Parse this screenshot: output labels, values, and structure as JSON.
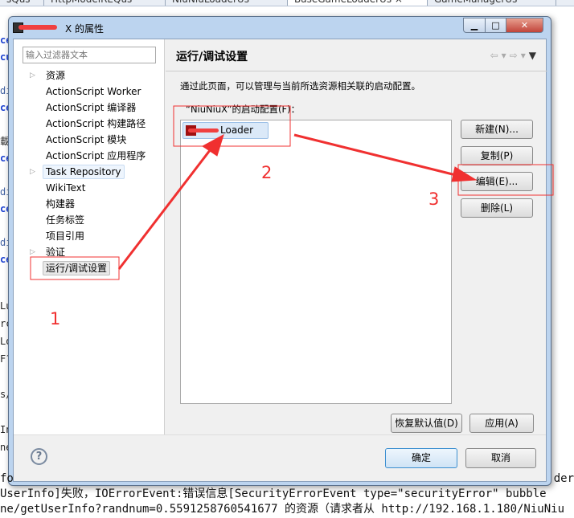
{
  "editor_tabs": [
    "sQus",
    "HttpModelREQus",
    "NiuNiuLoaderUs",
    "BaseGameLoaderUs ×",
    "GameManagerUs"
  ],
  "dialog": {
    "title": "X 的属性",
    "filter_placeholder": "输入过滤器文本",
    "tree": [
      {
        "label": "资源",
        "expandable": true
      },
      {
        "label": "ActionScript Worker"
      },
      {
        "label": "ActionScript 编译器"
      },
      {
        "label": "ActionScript 构建路径"
      },
      {
        "label": "ActionScript 模块"
      },
      {
        "label": "ActionScript 应用程序"
      },
      {
        "label": "Task Repository",
        "expandable": true,
        "highlighted": true
      },
      {
        "label": "WikiText"
      },
      {
        "label": "构建器"
      },
      {
        "label": "任务标签"
      },
      {
        "label": "项目引用"
      },
      {
        "label": "验证",
        "expandable": true
      },
      {
        "label": "运行/调试设置",
        "selected": true
      }
    ],
    "page": {
      "heading": "运行/调试设置",
      "description": "通过此页面，可以管理与当前所选资源相关联的启动配置。",
      "config_label": "“NiuNiuX”的启动配置(F)：",
      "config_items": [
        "Loader"
      ],
      "buttons": {
        "new": "新建(N)...",
        "copy": "复制(P)",
        "edit": "编辑(E)...",
        "delete": "删除(L)"
      },
      "restore_defaults": "恢复默认值(D)",
      "apply": "应用(A)"
    },
    "ok": "确定",
    "cancel": "取消",
    "help_icon": "?"
  },
  "annotations": {
    "labels": [
      "1",
      "2",
      "3"
    ],
    "color": "#f03030"
  },
  "console": [
    "fo                                                                                          der",
    "UserInfo]失败，IOErrorEvent:错误信息[SecurityErrorEvent type=\"securityError\" bubble",
    "ne/getUserInfo?randnum=0.5591258760541677 的资源（请求者从 http://192.168.1.180/NiuNiu"
  ]
}
